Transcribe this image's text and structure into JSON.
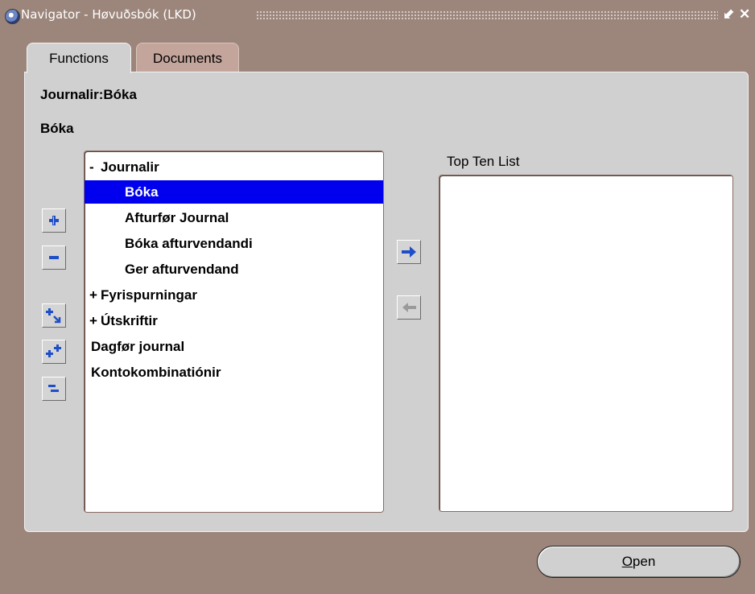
{
  "window": {
    "title": "Navigator - Høvuðsbók (LKD)",
    "minimize_glyph": "⬋",
    "close_glyph": "✕"
  },
  "tabs": [
    {
      "label": "Functions",
      "active": true
    },
    {
      "label": "Documents",
      "active": false
    }
  ],
  "breadcrumb": "Journalir:Bóka",
  "current_function": "Bóka",
  "tree": {
    "items": [
      {
        "prefix": "-",
        "label": "Journalir",
        "level": 0,
        "selected": false
      },
      {
        "prefix": "",
        "label": "Bóka",
        "level": 1,
        "selected": true
      },
      {
        "prefix": "",
        "label": "Afturfør Journal",
        "level": 1,
        "selected": false
      },
      {
        "prefix": "",
        "label": "Bóka afturvendandi",
        "level": 1,
        "selected": false
      },
      {
        "prefix": "",
        "label": "Ger afturvendand",
        "level": 1,
        "selected": false
      },
      {
        "prefix": "+",
        "label": "Fyrispurningar",
        "level": 0,
        "selected": false
      },
      {
        "prefix": "+",
        "label": "Útskriftir",
        "level": 0,
        "selected": false
      },
      {
        "prefix": "",
        "label": "Dagfør journal",
        "level": 0,
        "selected": false
      },
      {
        "prefix": "",
        "label": "Kontokombinatiónir",
        "level": 0,
        "selected": false
      }
    ]
  },
  "toolbar_icons": {
    "expand": "plus-icon",
    "collapse": "minus-icon",
    "expand_branch": "expand-branch-icon",
    "expand_all": "expand-all-icon",
    "collapse_all": "collapse-all-icon",
    "add_to_top_ten": "arrow-right-icon",
    "remove_from_top_ten": "arrow-left-icon"
  },
  "top_ten": {
    "label": "Top Ten List",
    "items": []
  },
  "open_button": {
    "mnemonic": "O",
    "rest": "pen"
  },
  "colors": {
    "background": "#9c857b",
    "panel": "#d0d0d0",
    "selection": "#0000ee",
    "icon_blue": "#1f4fc8"
  }
}
